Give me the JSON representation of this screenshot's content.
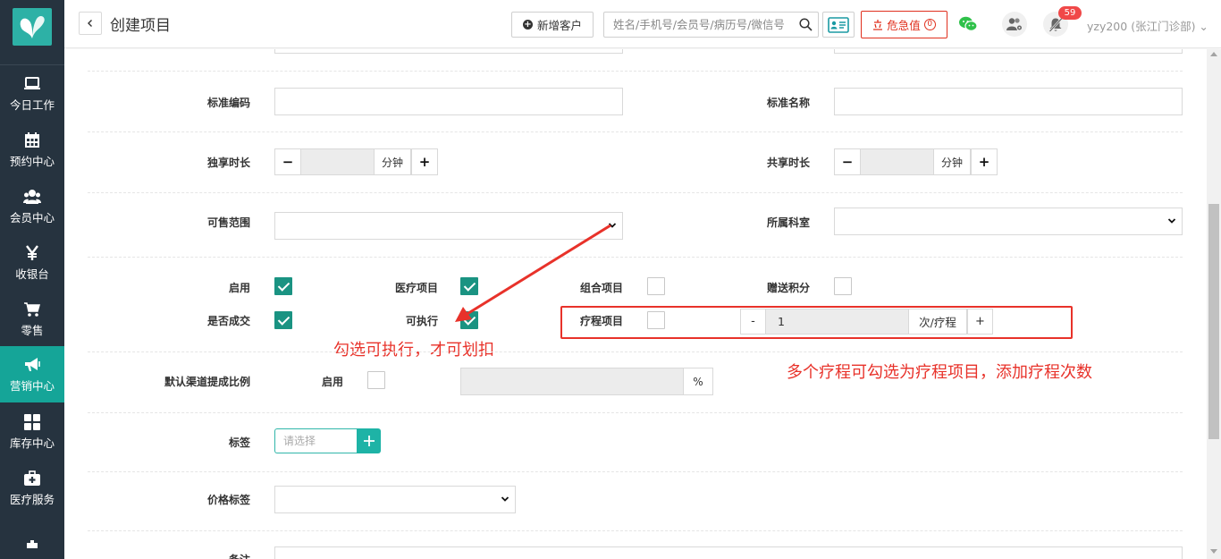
{
  "header": {
    "title": "创建项目",
    "new_customer": "新增客户",
    "search_placeholder": "姓名/手机号/会员号/病历号/微信号",
    "danger_label": "危急值",
    "danger_count": "0",
    "notification_count": "59",
    "user": "yzy200 (张江门诊部) ⌄"
  },
  "sidebar": {
    "items": [
      {
        "label": "今日工作",
        "icon": "monitor-icon"
      },
      {
        "label": "预约中心",
        "icon": "calendar-icon"
      },
      {
        "label": "会员中心",
        "icon": "users-icon"
      },
      {
        "label": "收银台",
        "icon": "yen-icon"
      },
      {
        "label": "零售",
        "icon": "cart-icon"
      },
      {
        "label": "营销中心",
        "icon": "megaphone-icon"
      },
      {
        "label": "库存中心",
        "icon": "grid-icon"
      },
      {
        "label": "医疗服务",
        "icon": "medkit-icon"
      }
    ],
    "active_index": 5,
    "active_color": "#15a598"
  },
  "form": {
    "standard_code": "标准编码",
    "standard_name": "标准名称",
    "exclusive_duration": "独享时长",
    "shared_duration": "共享时长",
    "minute_unit": "分钟",
    "sale_scope": "可售范围",
    "department": "所属科室",
    "enable": "启用",
    "medical_item": "医疗项目",
    "combo_item": "组合项目",
    "gift_points": "赠送积分",
    "is_deal": "是否成交",
    "executable": "可执行",
    "treatment_item": "疗程项目",
    "treatment_count": "1",
    "treatment_unit": "次/疗程",
    "minus": "-",
    "plus": "+",
    "default_channel_ratio": "默认渠道提成比例",
    "channel_enable": "启用",
    "percent": "%",
    "tags": "标签",
    "tags_placeholder": "请选择",
    "price_tag": "价格标签",
    "remark": "备注"
  },
  "checks": {
    "enable": true,
    "medical_item": true,
    "combo_item": false,
    "gift_points": false,
    "is_deal": true,
    "executable": true,
    "treatment_item": false,
    "channel_enable": false
  },
  "annotations": {
    "executable_note": "勾选可执行，才可划扣",
    "treatment_note": "多个疗程可勾选为疗程项目，添加疗程次数"
  },
  "colors": {
    "accent": "#1a9382",
    "annotation": "#e8322a",
    "sidebar_bg": "#26333f"
  }
}
